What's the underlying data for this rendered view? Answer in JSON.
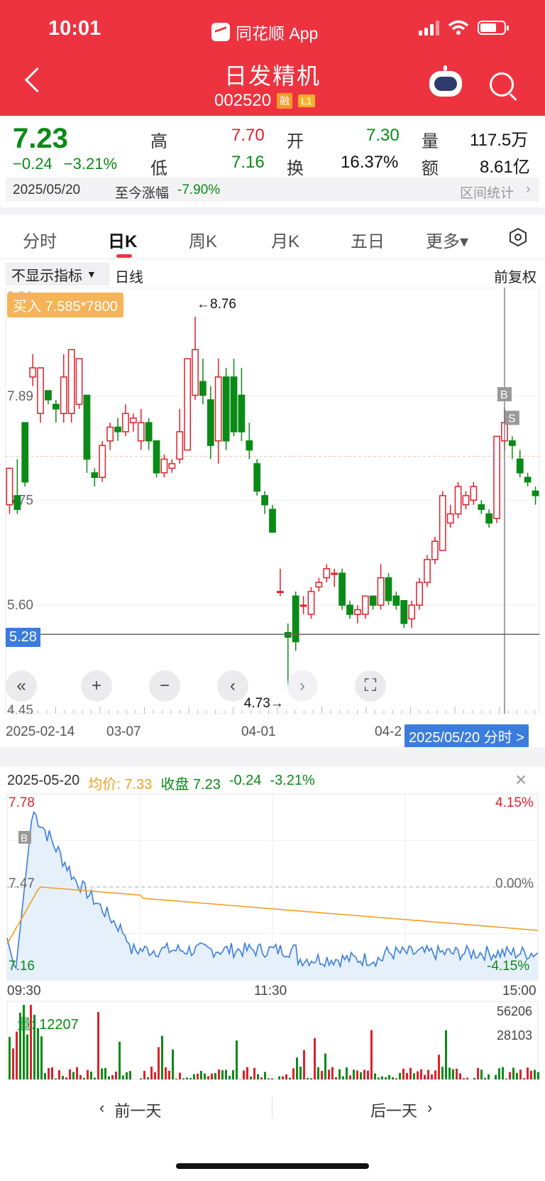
{
  "status": {
    "time": "10:01",
    "app": "同花顺 App"
  },
  "header": {
    "title": "日发精机",
    "code": "002520",
    "badge1": "融",
    "badge2": "L1"
  },
  "quote": {
    "price": "7.23",
    "change": "−0.24",
    "change_pct": "−3.21%",
    "high_label": "高",
    "high": "7.70",
    "low_label": "低",
    "low": "7.16",
    "open_label": "开",
    "open": "7.30",
    "turnover_label": "换",
    "turnover": "16.37%",
    "volume_label": "量",
    "volume": "117.5万",
    "amount_label": "额",
    "amount": "8.61亿"
  },
  "datebar": {
    "date": "2025/05/20",
    "since_label": "至今涨幅",
    "since_value": "-7.90%",
    "stats": "区间统计"
  },
  "tabs": [
    "分时",
    "日K",
    "周K",
    "月K",
    "五日",
    "更多▾"
  ],
  "indicators": {
    "button": "不显示指标",
    "line": "日线",
    "adjust": "前复权"
  },
  "kline": {
    "buy_tag": "买入 7.585*7800",
    "y_labels": [
      "7.89",
      "6.75",
      "5.60",
      "4.45"
    ],
    "y_partial_top": "9.04",
    "cursor_price": "5.28",
    "max_label": "←8.76",
    "min_label": "4.73→",
    "marker_b": "B",
    "marker_s": "S",
    "x_labels": [
      "2025-02-14",
      "03-07",
      "04-01",
      "04-2"
    ],
    "date_tag": "2025/05/20 分时 >"
  },
  "chart_data": {
    "type": "candlestick",
    "ylim": [
      4.45,
      9.04
    ],
    "candles": [
      [
        6.7,
        7.1,
        6.6,
        6.85
      ],
      [
        6.8,
        6.65,
        6.6,
        7.2
      ],
      [
        7.6,
        6.95,
        6.9,
        7.6
      ],
      [
        8.1,
        8.2,
        8.0,
        8.35
      ],
      [
        7.7,
        8.2,
        7.6,
        8.1
      ],
      [
        7.95,
        7.85,
        7.8,
        7.9
      ],
      [
        7.8,
        7.75,
        7.6,
        7.85
      ],
      [
        7.7,
        8.1,
        7.6,
        8.35
      ],
      [
        7.7,
        8.4,
        7.6,
        8.4
      ],
      [
        7.8,
        8.3,
        7.75,
        8.3
      ],
      [
        7.9,
        7.2,
        7.05,
        7.9
      ],
      [
        7.05,
        7.0,
        6.9,
        7.1
      ],
      [
        7.0,
        7.35,
        6.95,
        7.4
      ],
      [
        7.4,
        7.55,
        7.3,
        7.6
      ],
      [
        7.55,
        7.5,
        7.4,
        7.65
      ],
      [
        7.5,
        7.7,
        7.45,
        7.8
      ],
      [
        7.6,
        7.65,
        7.5,
        7.7
      ],
      [
        7.4,
        7.6,
        7.3,
        7.75
      ],
      [
        7.6,
        7.4,
        7.3,
        7.65
      ],
      [
        7.4,
        7.05,
        7.0,
        7.4
      ],
      [
        7.05,
        7.2,
        7.0,
        7.25
      ],
      [
        7.1,
        7.15,
        7.05,
        7.2
      ],
      [
        7.2,
        7.5,
        7.15,
        7.75
      ],
      [
        7.3,
        8.3,
        7.3,
        8.3
      ],
      [
        7.9,
        8.4,
        7.85,
        8.76
      ],
      [
        8.05,
        7.9,
        7.8,
        8.3
      ],
      [
        7.85,
        7.35,
        7.2,
        8.0
      ],
      [
        7.4,
        8.1,
        7.15,
        8.3
      ],
      [
        8.1,
        7.4,
        7.3,
        8.2
      ],
      [
        8.1,
        7.5,
        7.45,
        8.3
      ],
      [
        7.9,
        7.5,
        7.4,
        8.2
      ],
      [
        7.4,
        7.3,
        7.2,
        7.6
      ],
      [
        7.15,
        6.85,
        6.8,
        7.2
      ],
      [
        6.8,
        6.7,
        6.6,
        6.85
      ],
      [
        6.65,
        6.4,
        6.4,
        6.7
      ],
      [
        5.75,
        5.75,
        5.7,
        6.0
      ],
      [
        5.3,
        5.25,
        4.73,
        5.4
      ],
      [
        5.7,
        5.2,
        5.1,
        5.75
      ],
      [
        5.6,
        5.6,
        5.5,
        5.7
      ],
      [
        5.5,
        5.75,
        5.45,
        5.8
      ],
      [
        5.8,
        5.85,
        5.75,
        5.9
      ],
      [
        5.9,
        6.0,
        5.85,
        6.05
      ],
      [
        5.95,
        5.95,
        5.8,
        6.0
      ],
      [
        5.95,
        5.6,
        5.55,
        6.0
      ],
      [
        5.6,
        5.5,
        5.45,
        5.65
      ],
      [
        5.5,
        5.55,
        5.4,
        5.6
      ],
      [
        5.5,
        5.7,
        5.45,
        5.7
      ],
      [
        5.7,
        5.6,
        5.55,
        5.7
      ],
      [
        5.6,
        5.9,
        5.55,
        6.05
      ],
      [
        5.9,
        5.65,
        5.6,
        5.95
      ],
      [
        5.7,
        5.6,
        5.55,
        5.75
      ],
      [
        5.65,
        5.4,
        5.35,
        5.65
      ],
      [
        5.45,
        5.6,
        5.35,
        5.65
      ],
      [
        5.6,
        5.85,
        5.55,
        5.9
      ],
      [
        5.85,
        6.1,
        5.8,
        6.15
      ],
      [
        6.1,
        6.3,
        6.05,
        6.35
      ],
      [
        6.2,
        6.8,
        6.2,
        6.85
      ],
      [
        6.5,
        6.6,
        6.45,
        6.7
      ],
      [
        6.6,
        6.9,
        6.55,
        6.95
      ],
      [
        6.7,
        6.8,
        6.65,
        6.85
      ],
      [
        6.75,
        6.9,
        6.7,
        6.95
      ],
      [
        6.7,
        6.65,
        6.6,
        6.75
      ],
      [
        6.6,
        6.5,
        6.45,
        6.65
      ],
      [
        6.55,
        7.45,
        6.5,
        7.45
      ],
      [
        7.4,
        7.6,
        7.3,
        7.75
      ],
      [
        7.4,
        7.35,
        7.2,
        7.45
      ],
      [
        7.2,
        7.05,
        7.0,
        7.3
      ],
      [
        7.0,
        6.95,
        6.9,
        7.05
      ],
      [
        6.85,
        6.8,
        6.7,
        6.9
      ]
    ]
  },
  "intraday": {
    "date": "2025-05-20",
    "avg": "均价: 7.33",
    "close": "收盘 7.23",
    "chg": "-0.24",
    "pct": "-3.21%",
    "y_top": "7.78",
    "y_mid": "7.47",
    "y_bot": "7.16",
    "pct_top": "4.15%",
    "pct_mid": "0.00%",
    "pct_bot": "-4.15%",
    "time_start": "09:30",
    "time_mid": "11:30",
    "time_end": "15:00",
    "vol_label": "量: 12207",
    "vol_top": "56206",
    "vol_mid": "28103",
    "marker_b": "B"
  },
  "nav": {
    "prev": "前一天",
    "next": "后一天"
  }
}
